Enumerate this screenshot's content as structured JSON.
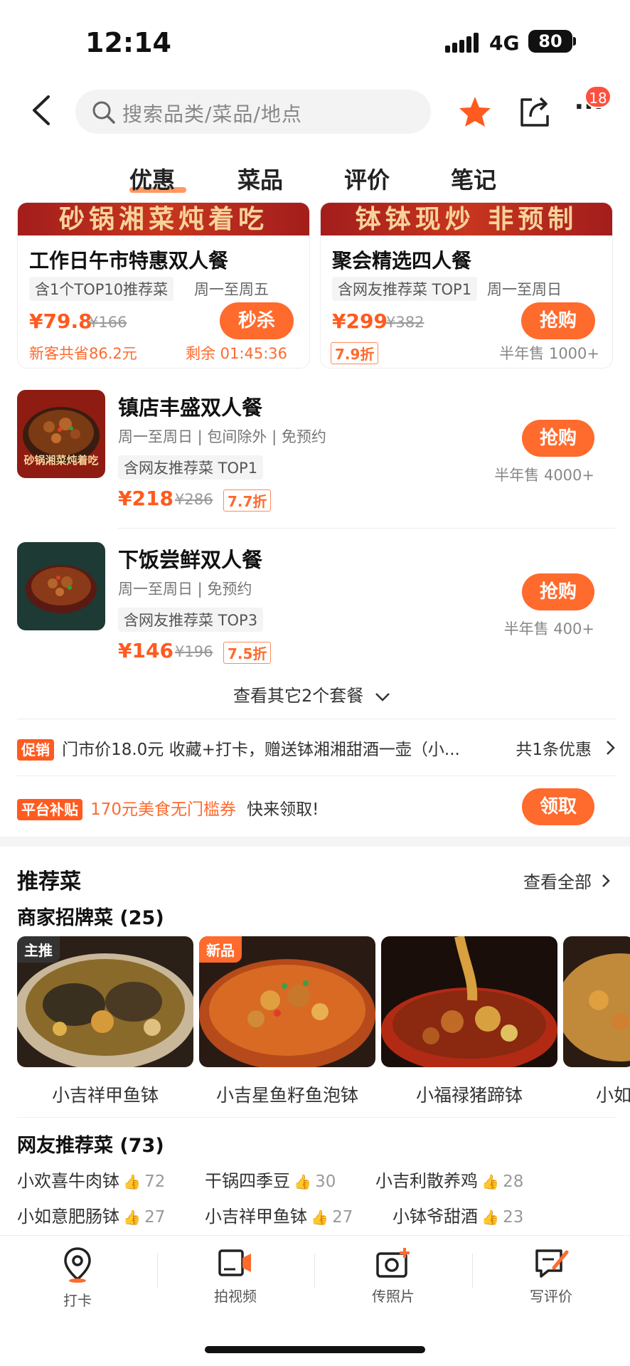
{
  "status_bar": {
    "time": "12:14",
    "network": "4G",
    "battery": "80"
  },
  "nav": {
    "search_placeholder": "搜索品类/菜品/地点",
    "more_badge": "18"
  },
  "tabs": [
    {
      "label": "优惠",
      "active": true
    },
    {
      "label": "菜品"
    },
    {
      "label": "评价"
    },
    {
      "label": "笔记"
    }
  ],
  "deal_cards": [
    {
      "banner": "砂锅湘菜炖着吃",
      "title": "工作日午市特惠双人餐",
      "tag": "含1个TOP10推荐菜",
      "days": "周一至周五",
      "price": "¥79.8",
      "orig_price": "¥166",
      "button": "秒杀",
      "save_note": "新客共省86.2元",
      "countdown": "剩余 01:45:36"
    },
    {
      "banner": "钵钵现炒 非预制",
      "title": "聚会精选四人餐",
      "tag": "含网友推荐菜 TOP1",
      "days": "周一至周日",
      "price": "¥299",
      "orig_price": "¥382",
      "button": "抢购",
      "discount": "7.9折",
      "sold": "半年售 1000+"
    }
  ],
  "set_meals": [
    {
      "title": "镇店丰盛双人餐",
      "sub": "周一至周日 | 包间除外 | 免预约",
      "tag": "含网友推荐菜 TOP1",
      "price": "¥218",
      "orig_price": "¥286",
      "discount": "7.7折",
      "button": "抢购",
      "sold": "半年售 4000+",
      "thumb_caption": "砂锅湘菜炖着吃"
    },
    {
      "title": "下饭尝鲜双人餐",
      "sub": "周一至周日 | 免预约",
      "tag": "含网友推荐菜 TOP3",
      "price": "¥146",
      "orig_price": "¥196",
      "discount": "7.5折",
      "button": "抢购",
      "sold": "半年售 400+"
    }
  ],
  "more_sets": "查看其它2个套餐",
  "promo": {
    "tag": "促销",
    "text": "门市价18.0元 收藏+打卡，赠送钵湘湘甜酒一壶（小...",
    "count": "共1条优惠"
  },
  "subsidy": {
    "tag": "平台补贴",
    "highlight": "170元美食无门槛券",
    "text": "快来领取!",
    "button": "领取"
  },
  "recommend": {
    "title": "推荐菜",
    "view_all": "查看全部",
    "signature_title": "商家招牌菜 (25)",
    "dishes": [
      {
        "name": "小吉祥甲鱼钵",
        "label": "主推"
      },
      {
        "name": "小吉星鱼籽鱼泡钵",
        "label": "新品"
      },
      {
        "name": "小福禄猪蹄钵"
      },
      {
        "name": "小如"
      }
    ],
    "netizen_title": "网友推荐菜 (73)",
    "netizen": [
      {
        "name": "小欢喜牛肉钵",
        "count": "72"
      },
      {
        "name": "干锅四季豆",
        "count": "30"
      },
      {
        "name": "小吉利散养鸡",
        "count": "28"
      },
      {
        "name": "小如意肥肠钵",
        "count": "27"
      },
      {
        "name": "小吉祥甲鱼钵",
        "count": "27"
      },
      {
        "name": "小钵爷甜酒",
        "count": "23"
      }
    ]
  },
  "bottom_bar": [
    {
      "label": "打卡"
    },
    {
      "label": "拍视频"
    },
    {
      "label": "传照片"
    },
    {
      "label": "写评价"
    }
  ],
  "colors": {
    "accent": "#ff6a2d",
    "price": "#ff5a1f",
    "banner": "#a31d1c"
  }
}
